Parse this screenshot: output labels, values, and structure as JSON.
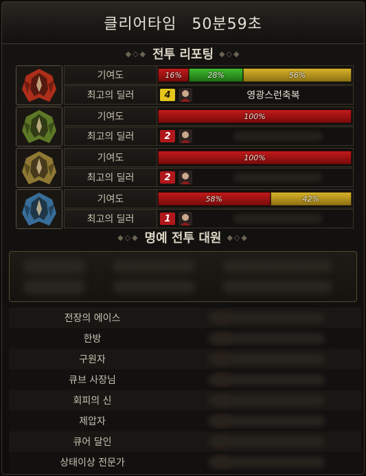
{
  "title": {
    "label": "클리어타임",
    "time": "50분59초"
  },
  "battle_report": {
    "header": "전투 리포팅",
    "contribution_label": "기여도",
    "best_dealer_label": "최고의 딜러",
    "bosses": [
      {
        "icon": "red-helmet-boss-icon",
        "accent": "#c8321c",
        "segments": [
          {
            "pct": 16,
            "label": "16%",
            "color": "red"
          },
          {
            "pct": 28,
            "label": "28%",
            "color": "green"
          },
          {
            "pct": 56,
            "label": "56%",
            "color": "yellow"
          }
        ],
        "dealer": {
          "rank": "4",
          "rank_color": "yellow",
          "name": "영광스런축복"
        }
      },
      {
        "icon": "green-helmet-boss-icon",
        "accent": "#6a8a2b",
        "segments": [
          {
            "pct": 100,
            "label": "100%",
            "color": "red"
          }
        ],
        "dealer": {
          "rank": "2",
          "rank_color": "red",
          "name": ""
        }
      },
      {
        "icon": "gold-helmet-boss-icon",
        "accent": "#a38a3a",
        "segments": [
          {
            "pct": 100,
            "label": "100%",
            "color": "red"
          }
        ],
        "dealer": {
          "rank": "2",
          "rank_color": "red",
          "name": ""
        }
      },
      {
        "icon": "blue-helmet-boss-icon",
        "accent": "#3d7db0",
        "segments": [
          {
            "pct": 58,
            "label": "58%",
            "color": "red"
          },
          {
            "pct": 42,
            "label": "42%",
            "color": "yellow"
          }
        ],
        "dealer": {
          "rank": "1",
          "rank_color": "red",
          "name": ""
        }
      }
    ]
  },
  "honor": {
    "header": "명예 전투 대원",
    "categories": [
      "전장의 에이스",
      "한방",
      "구원자",
      "큐브 사장님",
      "회피의 신",
      "제압자",
      "큐어 달인",
      "상태이상 전문가"
    ]
  }
}
